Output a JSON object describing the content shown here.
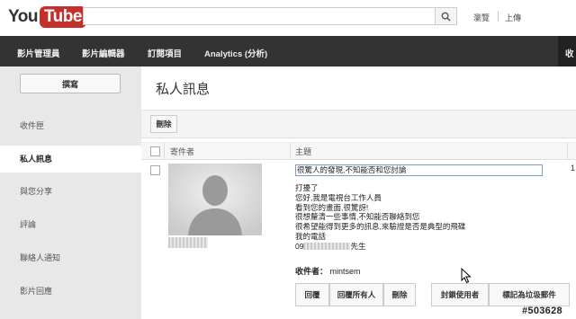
{
  "brand": {
    "you": "You",
    "tube": "Tube",
    "color": "#c4302b"
  },
  "header": {
    "search_placeholder": "",
    "browse": "瀏覽",
    "upload": "上傳"
  },
  "nav": {
    "items": [
      "影片管理員",
      "影片編輯器",
      "訂閱項目",
      "Analytics (分析)"
    ],
    "right_fragment": "收"
  },
  "sidebar": {
    "compose": "撰寫",
    "items": [
      "收件匣",
      "私人訊息",
      "與您分享",
      "評論",
      "聯絡人通知",
      "影片回應"
    ],
    "active_index": 1
  },
  "main": {
    "title": "私人訊息",
    "delete_button": "刪除",
    "columns": {
      "sender": "寄件者",
      "subject": "主題"
    },
    "message": {
      "subject": "很驚人的發現,不知能否和您討論",
      "body": [
        "打擾了",
        "您好,我是電視台工作人員",
        "看到您的畫面,很驚訝!",
        "很想釐清一些事情,不知能否聯絡到您",
        "很希望能得到更多的訊息,來驗證是否是典型的飛碟",
        "我的電話"
      ],
      "phone_prefix": "09",
      "phone_suffix": "先生",
      "recipient_label": "收件者：",
      "recipient": "mintsem",
      "right_number": "1",
      "actions": [
        "回覆",
        "回覆所有人",
        "刪除",
        "封鎖使用者",
        "標記為垃圾郵件"
      ]
    }
  },
  "watermark": "#503628"
}
